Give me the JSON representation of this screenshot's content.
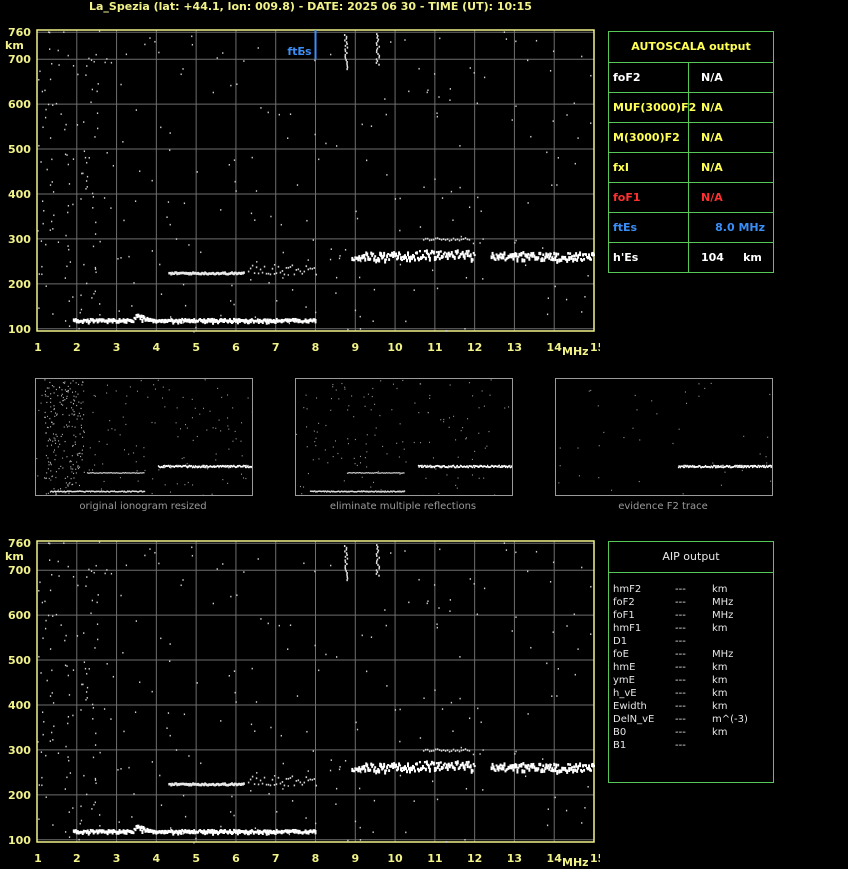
{
  "title": "La_Spezia (lat: +44.1, lon: 009.8) - DATE: 2025 06 30 - TIME (UT): 10:15",
  "colors": {
    "axis": "#f2f28a",
    "grid": "#6e6e6e",
    "box": "#55c855",
    "ftes": "#3a8ef6",
    "fof1": "#ff3030",
    "autoscala_title": "#ffff55"
  },
  "chart_data": [
    {
      "type": "scatter",
      "name": "ionogram-top",
      "xlabel": "MHz",
      "ylabel": "km",
      "xlim": [
        1,
        15
      ],
      "ylim": [
        95,
        765
      ],
      "xticks": [
        "1",
        "2",
        "3",
        "4",
        "5",
        "6",
        "7",
        "8",
        "9",
        "10",
        "11",
        "12",
        "13",
        "14",
        "15"
      ],
      "yticks": [
        "100",
        "200",
        "300",
        "400",
        "500",
        "600",
        "700",
        "760"
      ],
      "grid": true,
      "marker": {
        "label": "ftEs",
        "x": 8.0,
        "y_from": 700,
        "y_to": 765
      },
      "traces": [
        {
          "label": "E/Es trace",
          "x_from": 1.9,
          "x_to": 8.0,
          "y": 118
        },
        {
          "label": "Es 2nd hop",
          "x_from": 4.3,
          "x_to": 6.2,
          "y": 225
        },
        {
          "label": "F trace",
          "x_from": 8.9,
          "x_to": 15.0,
          "y": 262
        }
      ]
    },
    {
      "type": "scatter",
      "name": "ionogram-bottom",
      "xlabel": "MHz",
      "ylabel": "km",
      "xlim": [
        1,
        15
      ],
      "ylim": [
        95,
        765
      ],
      "xticks": [
        "1",
        "2",
        "3",
        "4",
        "5",
        "6",
        "7",
        "8",
        "9",
        "10",
        "11",
        "12",
        "13",
        "14",
        "15"
      ],
      "yticks": [
        "100",
        "200",
        "300",
        "400",
        "500",
        "600",
        "700",
        "760"
      ],
      "grid": true
    }
  ],
  "thumbnails": [
    {
      "caption": "original ionogram resized"
    },
    {
      "caption": "eliminate multiple reflections"
    },
    {
      "caption": "evidence F2 trace"
    }
  ],
  "autoscala": {
    "title": "AUTOSCALA output",
    "rows": [
      {
        "name": "foF2",
        "value": "N/A",
        "color": "#ffffff"
      },
      {
        "name": "MUF(3000)F2",
        "value": "N/A",
        "color": "#ffff55"
      },
      {
        "name": "M(3000)F2",
        "value": "N/A",
        "color": "#ffff55"
      },
      {
        "name": "fxI",
        "value": "N/A",
        "color": "#ffff55"
      },
      {
        "name": "foF1",
        "value": "N/A",
        "color": "#ff3030"
      },
      {
        "name": "ftEs",
        "value": "8.0 MHz",
        "color": "#3a8ef6"
      },
      {
        "name": "h'Es",
        "value": "104     km",
        "color": "#ffffff"
      }
    ]
  },
  "aip": {
    "title": "AIP output",
    "rows": [
      {
        "name": "hmF2",
        "value": "---",
        "unit": "km"
      },
      {
        "name": "foF2",
        "value": "---",
        "unit": "MHz"
      },
      {
        "name": "foF1",
        "value": "---",
        "unit": "MHz"
      },
      {
        "name": "hmF1",
        "value": "---",
        "unit": "km"
      },
      {
        "name": "D1",
        "value": "---",
        "unit": ""
      },
      {
        "name": "foE",
        "value": "---",
        "unit": "MHz"
      },
      {
        "name": "hmE",
        "value": "---",
        "unit": "km"
      },
      {
        "name": "ymE",
        "value": "---",
        "unit": "km"
      },
      {
        "name": "h_vE",
        "value": "---",
        "unit": "km"
      },
      {
        "name": "Ewidth",
        "value": "---",
        "unit": "km"
      },
      {
        "name": "DelN_vE",
        "value": "---",
        "unit": "m^(-3)"
      },
      {
        "name": "B0",
        "value": "---",
        "unit": "km"
      },
      {
        "name": "B1",
        "value": "---",
        "unit": ""
      }
    ]
  }
}
